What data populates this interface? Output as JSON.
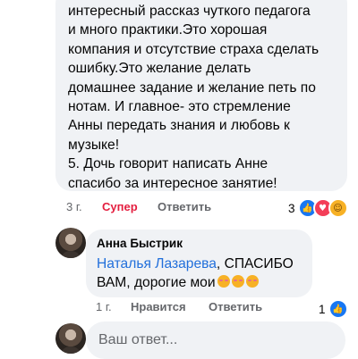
{
  "comment": {
    "text": "интересный рассказ чуткого педагога\nи много практики.Это хорошая\nкомпания и отсутствие страха сделать\nошибку.Это желание делать\nдомашнее задание и желание петь по\nнотам. И главное- это стремление\nАнны передать знания и любовь к\nмузыке!\n5. Дочь говорит написать Анне\nспасибо за интересное занятие!",
    "time": "3 г.",
    "reaction_label": "Супер",
    "reply_label": "Ответить",
    "reaction_count": "3",
    "reaction_icons": [
      "like-icon",
      "love-icon",
      "care-icon"
    ]
  },
  "reply": {
    "author": "Анна Быстрик",
    "mention": "Наталья Лазарева",
    "text_line1_rest": ", СПАСИБО",
    "text_line2": "ВАМ, дорогие мои",
    "emoji_count": 3,
    "emoji_icon": "smiling-face-with-hearts-icon",
    "time": "1 г.",
    "like_label": "Нравится",
    "reply_label": "Ответить",
    "reaction_count": "1",
    "reaction_icons": [
      "like-icon"
    ]
  },
  "composer": {
    "placeholder": "Ваш ответ..."
  },
  "colors": {
    "bubble": "#f0f2f5",
    "mention": "#216fdb",
    "super_reaction": "#e41e3f",
    "like": "#1877f2",
    "love": "#f33e58",
    "care": "#f7b125"
  }
}
